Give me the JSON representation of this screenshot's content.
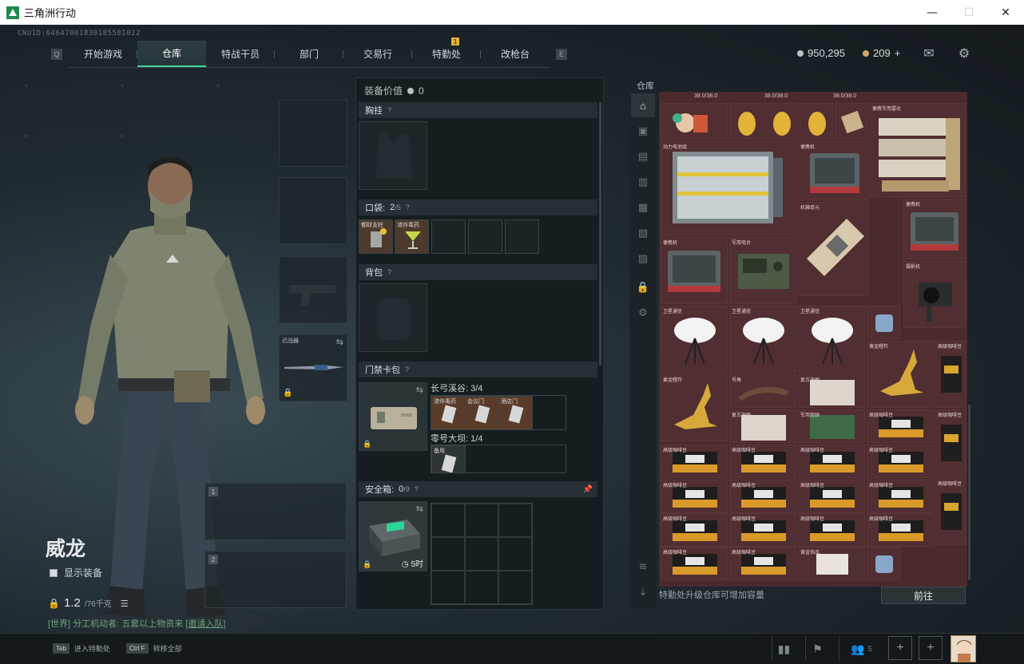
{
  "window": {
    "title": "三角洲行动",
    "minimize": "—",
    "maximize": "☐",
    "close": "✕"
  },
  "uid": "CNUID:6464700183018558I022",
  "nav": {
    "prev_key": "Q",
    "next_key": "E",
    "badge": "1",
    "tabs": [
      {
        "label": "开始游戏"
      },
      {
        "label": "仓库",
        "active": true
      },
      {
        "label": "特战干员"
      },
      {
        "label": "部门"
      },
      {
        "label": "交易行"
      },
      {
        "label": "特勤处"
      },
      {
        "label": "改枪台"
      }
    ]
  },
  "currency": {
    "coins": "950,295",
    "tickets": "209",
    "plus": "+"
  },
  "operator": {
    "name": "威龙",
    "show_gear_label": "显示装备",
    "weight": "1.2",
    "weight_max": "/76千克"
  },
  "weapon_slots": [
    {
      "num": "1"
    },
    {
      "num": "2"
    }
  ],
  "melee_label": "近战器",
  "chat": {
    "prefix": "[世界]",
    "text": "分工机动者: 五套以上物资来",
    "link": "[邀请入队]"
  },
  "hints": [
    {
      "key": "Tab",
      "label": "进入特勤处"
    },
    {
      "key": "Ctrl F",
      "label": "转移全部"
    }
  ],
  "bottom": {
    "friends_count": "5"
  },
  "equip": {
    "value_label": "装备价值",
    "value": "0",
    "chest_label": "胸挂",
    "pocket_label": "口袋:",
    "pocket_count": "2",
    "pocket_max": "/5",
    "pocket_items": [
      "都财支柱",
      "渣炸毒药"
    ],
    "backpack_label": "背包",
    "keycard_label": "门禁卡包",
    "key_zone1": "长弓溪谷: 3/4",
    "key_zone1_items": [
      "渣炸毒药",
      "会议门",
      "酒店门"
    ],
    "key_zone2": "零号大坝: 1/4",
    "key_zone2_items": [
      "备用"
    ],
    "safe_label": "安全箱:",
    "safe_count": "0",
    "safe_max": "/9",
    "safe_timer": "5时",
    "help": "?"
  },
  "warehouse": {
    "title": "仓库",
    "footer": "特勤处升级仓库可增加容量",
    "go_button": "前往",
    "top_row": [
      "38.0/38.0",
      "38.0/38.0",
      "38.0/38.0"
    ],
    "labels": {
      "power_battery": "动力电池组",
      "laptop": "便携机",
      "server": "便携军用雷达",
      "cpu": "机箱单元",
      "radio": "军用电台",
      "camera": "摄影机",
      "satellite": "卫星通信",
      "horn": "号角",
      "deer": "黄金瞪羚",
      "map": "复古海图",
      "motherboard": "军用炮弹",
      "tape": "高级咖啡豆",
      "coffee": "高级咖啡豆",
      "card": "黄金饰品",
      "cash": "富豪现金"
    }
  }
}
